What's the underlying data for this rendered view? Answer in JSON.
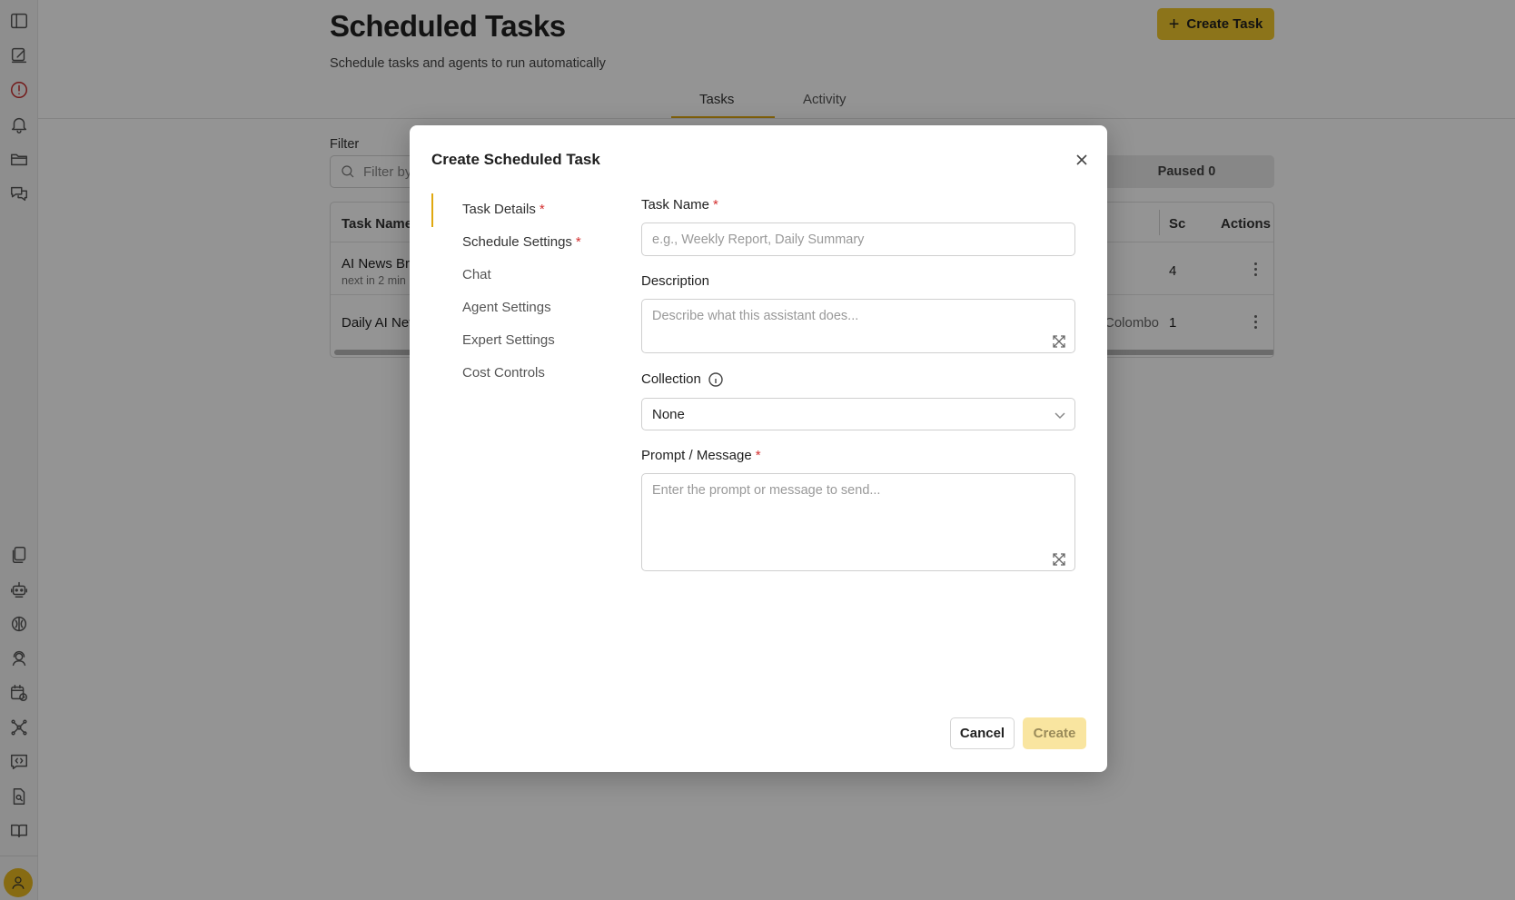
{
  "sidebar": {
    "icons": [
      "sidebar-toggle-icon",
      "edit-icon",
      "alert-icon",
      "bell-icon",
      "folder-icon",
      "chat-icon",
      "documents-icon",
      "robot-icon",
      "brain-icon",
      "user-headset-icon",
      "calendar-clock-icon",
      "network-icon",
      "code-chat-icon",
      "file-search-icon",
      "book-icon"
    ],
    "avatar_icon": "user-icon"
  },
  "page": {
    "title": "Scheduled Tasks",
    "subtitle": "Schedule tasks and agents to run automatically",
    "create_button": "Create Task",
    "tabs": [
      {
        "label": "Tasks",
        "active": true
      },
      {
        "label": "Activity",
        "active": false
      }
    ],
    "filter_label": "Filter",
    "filter_placeholder": "Filter by",
    "paused_label": "Paused 0"
  },
  "table": {
    "headers": {
      "name": "Task Name",
      "sc": "Sc",
      "actions": "Actions"
    },
    "rows": [
      {
        "name": "AI News Bri",
        "sub": "next in 2 min",
        "tz": "",
        "sc": "4"
      },
      {
        "name": "Daily AI Nev",
        "sub": "",
        "tz": "Colombo",
        "sc": "1"
      }
    ]
  },
  "modal": {
    "title": "Create Scheduled Task",
    "nav": [
      {
        "label": "Task Details",
        "required": true,
        "active": true
      },
      {
        "label": "Schedule Settings",
        "required": true,
        "active": false
      },
      {
        "label": "Chat",
        "required": false,
        "active": false
      },
      {
        "label": "Agent Settings",
        "required": false,
        "active": false
      },
      {
        "label": "Expert Settings",
        "required": false,
        "active": false
      },
      {
        "label": "Cost Controls",
        "required": false,
        "active": false
      }
    ],
    "fields": {
      "task_name_label": "Task Name",
      "task_name_placeholder": "e.g., Weekly Report, Daily Summary",
      "description_label": "Description",
      "description_placeholder": "Describe what this assistant does...",
      "collection_label": "Collection",
      "collection_value": "None",
      "prompt_label": "Prompt / Message",
      "prompt_placeholder": "Enter the prompt or message to send..."
    },
    "required_mark": "*",
    "cancel_label": "Cancel",
    "create_label": "Create"
  },
  "colors": {
    "accent": "#f2c92e",
    "tab_underline": "#e0a810",
    "required": "#d32f2f",
    "alert_icon": "#c62828"
  }
}
